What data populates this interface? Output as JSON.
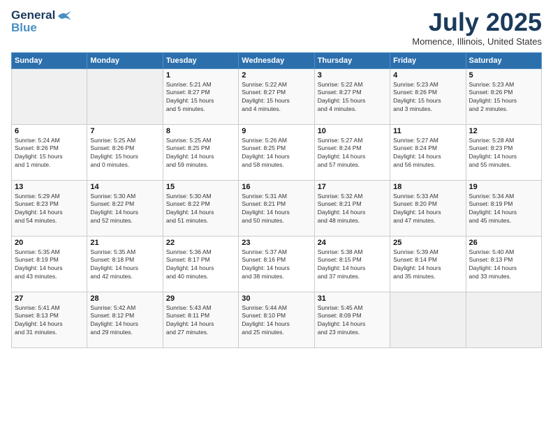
{
  "logo": {
    "line1": "General",
    "line2": "Blue"
  },
  "title": "July 2025",
  "location": "Momence, Illinois, United States",
  "weekdays": [
    "Sunday",
    "Monday",
    "Tuesday",
    "Wednesday",
    "Thursday",
    "Friday",
    "Saturday"
  ],
  "weeks": [
    [
      {
        "day": "",
        "info": ""
      },
      {
        "day": "",
        "info": ""
      },
      {
        "day": "1",
        "info": "Sunrise: 5:21 AM\nSunset: 8:27 PM\nDaylight: 15 hours\nand 5 minutes."
      },
      {
        "day": "2",
        "info": "Sunrise: 5:22 AM\nSunset: 8:27 PM\nDaylight: 15 hours\nand 4 minutes."
      },
      {
        "day": "3",
        "info": "Sunrise: 5:22 AM\nSunset: 8:27 PM\nDaylight: 15 hours\nand 4 minutes."
      },
      {
        "day": "4",
        "info": "Sunrise: 5:23 AM\nSunset: 8:26 PM\nDaylight: 15 hours\nand 3 minutes."
      },
      {
        "day": "5",
        "info": "Sunrise: 5:23 AM\nSunset: 8:26 PM\nDaylight: 15 hours\nand 2 minutes."
      }
    ],
    [
      {
        "day": "6",
        "info": "Sunrise: 5:24 AM\nSunset: 8:26 PM\nDaylight: 15 hours\nand 1 minute."
      },
      {
        "day": "7",
        "info": "Sunrise: 5:25 AM\nSunset: 8:26 PM\nDaylight: 15 hours\nand 0 minutes."
      },
      {
        "day": "8",
        "info": "Sunrise: 5:25 AM\nSunset: 8:25 PM\nDaylight: 14 hours\nand 59 minutes."
      },
      {
        "day": "9",
        "info": "Sunrise: 5:26 AM\nSunset: 8:25 PM\nDaylight: 14 hours\nand 58 minutes."
      },
      {
        "day": "10",
        "info": "Sunrise: 5:27 AM\nSunset: 8:24 PM\nDaylight: 14 hours\nand 57 minutes."
      },
      {
        "day": "11",
        "info": "Sunrise: 5:27 AM\nSunset: 8:24 PM\nDaylight: 14 hours\nand 56 minutes."
      },
      {
        "day": "12",
        "info": "Sunrise: 5:28 AM\nSunset: 8:23 PM\nDaylight: 14 hours\nand 55 minutes."
      }
    ],
    [
      {
        "day": "13",
        "info": "Sunrise: 5:29 AM\nSunset: 8:23 PM\nDaylight: 14 hours\nand 54 minutes."
      },
      {
        "day": "14",
        "info": "Sunrise: 5:30 AM\nSunset: 8:22 PM\nDaylight: 14 hours\nand 52 minutes."
      },
      {
        "day": "15",
        "info": "Sunrise: 5:30 AM\nSunset: 8:22 PM\nDaylight: 14 hours\nand 51 minutes."
      },
      {
        "day": "16",
        "info": "Sunrise: 5:31 AM\nSunset: 8:21 PM\nDaylight: 14 hours\nand 50 minutes."
      },
      {
        "day": "17",
        "info": "Sunrise: 5:32 AM\nSunset: 8:21 PM\nDaylight: 14 hours\nand 48 minutes."
      },
      {
        "day": "18",
        "info": "Sunrise: 5:33 AM\nSunset: 8:20 PM\nDaylight: 14 hours\nand 47 minutes."
      },
      {
        "day": "19",
        "info": "Sunrise: 5:34 AM\nSunset: 8:19 PM\nDaylight: 14 hours\nand 45 minutes."
      }
    ],
    [
      {
        "day": "20",
        "info": "Sunrise: 5:35 AM\nSunset: 8:19 PM\nDaylight: 14 hours\nand 43 minutes."
      },
      {
        "day": "21",
        "info": "Sunrise: 5:35 AM\nSunset: 8:18 PM\nDaylight: 14 hours\nand 42 minutes."
      },
      {
        "day": "22",
        "info": "Sunrise: 5:36 AM\nSunset: 8:17 PM\nDaylight: 14 hours\nand 40 minutes."
      },
      {
        "day": "23",
        "info": "Sunrise: 5:37 AM\nSunset: 8:16 PM\nDaylight: 14 hours\nand 38 minutes."
      },
      {
        "day": "24",
        "info": "Sunrise: 5:38 AM\nSunset: 8:15 PM\nDaylight: 14 hours\nand 37 minutes."
      },
      {
        "day": "25",
        "info": "Sunrise: 5:39 AM\nSunset: 8:14 PM\nDaylight: 14 hours\nand 35 minutes."
      },
      {
        "day": "26",
        "info": "Sunrise: 5:40 AM\nSunset: 8:13 PM\nDaylight: 14 hours\nand 33 minutes."
      }
    ],
    [
      {
        "day": "27",
        "info": "Sunrise: 5:41 AM\nSunset: 8:13 PM\nDaylight: 14 hours\nand 31 minutes."
      },
      {
        "day": "28",
        "info": "Sunrise: 5:42 AM\nSunset: 8:12 PM\nDaylight: 14 hours\nand 29 minutes."
      },
      {
        "day": "29",
        "info": "Sunrise: 5:43 AM\nSunset: 8:11 PM\nDaylight: 14 hours\nand 27 minutes."
      },
      {
        "day": "30",
        "info": "Sunrise: 5:44 AM\nSunset: 8:10 PM\nDaylight: 14 hours\nand 25 minutes."
      },
      {
        "day": "31",
        "info": "Sunrise: 5:45 AM\nSunset: 8:09 PM\nDaylight: 14 hours\nand 23 minutes."
      },
      {
        "day": "",
        "info": ""
      },
      {
        "day": "",
        "info": ""
      }
    ]
  ]
}
